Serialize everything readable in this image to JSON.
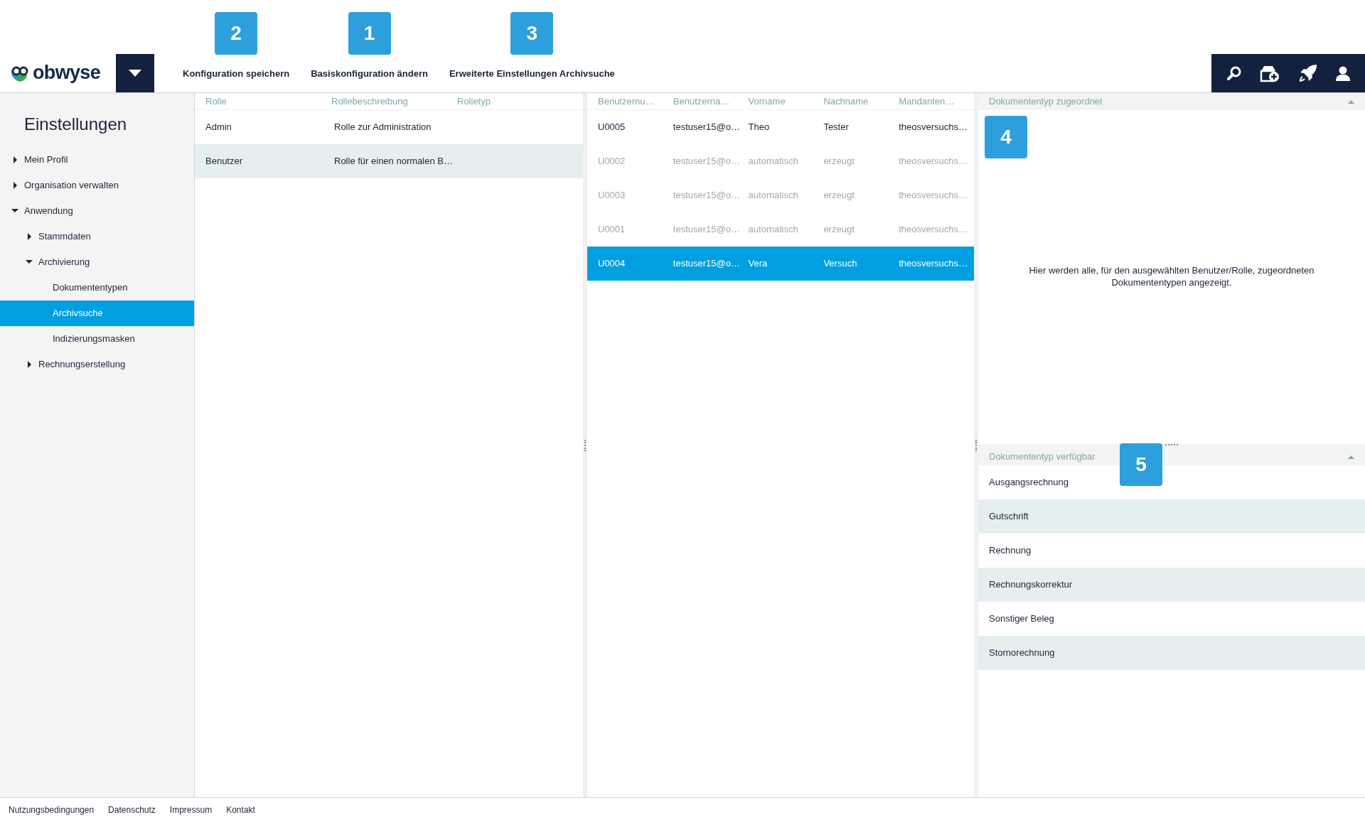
{
  "logo": "obwyse",
  "toolbar_actions": [
    {
      "label": "Konfiguration speichern",
      "callout": "2"
    },
    {
      "label": "Basiskonfiguration ändern",
      "callout": "1"
    },
    {
      "label": "Erweiterte Einstellungen Archivsuche",
      "callout": "3"
    }
  ],
  "sidebar": {
    "title": "Einstellungen",
    "items": [
      {
        "label": "Mein Profil",
        "kind": "folder",
        "expanded": false,
        "selected": false
      },
      {
        "label": "Organisation verwalten",
        "kind": "folder",
        "expanded": false,
        "selected": false
      },
      {
        "label": "Anwendung",
        "kind": "folder",
        "expanded": true,
        "selected": false,
        "children": [
          {
            "label": "Stammdaten",
            "kind": "folder",
            "expanded": false,
            "selected": false
          },
          {
            "label": "Archivierung",
            "kind": "folder",
            "expanded": true,
            "selected": false,
            "children": [
              {
                "label": "Dokumententypen",
                "kind": "leaf",
                "selected": false
              },
              {
                "label": "Archivsuche",
                "kind": "leaf",
                "selected": true
              },
              {
                "label": "Indizierungsmasken",
                "kind": "leaf",
                "selected": false
              }
            ]
          },
          {
            "label": "Rechnungserstellung",
            "kind": "folder",
            "expanded": false,
            "selected": false
          }
        ]
      }
    ]
  },
  "roles_table": {
    "columns": [
      "Rolle",
      "Rollebeschreibung",
      "Rolletyp"
    ],
    "rows": [
      {
        "cells": [
          "Admin",
          "Rolle zur Administration"
        ]
      },
      {
        "cells": [
          "Benutzer",
          "Rolle für einen normalen B…"
        ]
      }
    ]
  },
  "users_table": {
    "columns": [
      "Benutzernu…",
      "Benutzerna…",
      "Vorname",
      "Nachname",
      "Mandanten…"
    ],
    "rows": [
      {
        "cells": [
          "U0005",
          "testuser15@o…",
          "Theo",
          "Tester",
          "theosversuchs…"
        ],
        "inactive": false,
        "selected": false
      },
      {
        "cells": [
          "U0002",
          "testuser15@o…",
          "automatisch",
          "erzeugt",
          "theosversuchs…"
        ],
        "inactive": true,
        "selected": false
      },
      {
        "cells": [
          "U0003",
          "testuser15@o…",
          "automatisch",
          "erzeugt",
          "theosversuchs…"
        ],
        "inactive": true,
        "selected": false
      },
      {
        "cells": [
          "U0001",
          "testuser15@o…",
          "automatisch",
          "erzeugt",
          "theosversuchs…"
        ],
        "inactive": true,
        "selected": false
      },
      {
        "cells": [
          "U0004",
          "testuser15@o…",
          "Vera",
          "Versuch",
          "theosversuchs…"
        ],
        "inactive": false,
        "selected": true
      }
    ]
  },
  "assigned_panel": {
    "title": "Dokumententyp zugeordnet",
    "callout": "4",
    "message": "Hier werden alle, für den ausgewählten Benutzer/Rolle, zugeordneten Dokumententypen angezeigt."
  },
  "available_panel": {
    "title": "Dokumententyp verfügbar",
    "callout": "5",
    "items": [
      "Ausgangsrechnung",
      "Gutschrift",
      "Rechnung",
      "Rechnungskorrektur",
      "Sonstiger Beleg",
      "Stornorechnung"
    ]
  },
  "footer_links": [
    "Nutzungsbedingungen",
    "Datenschutz",
    "Impressum",
    "Kontakt"
  ]
}
